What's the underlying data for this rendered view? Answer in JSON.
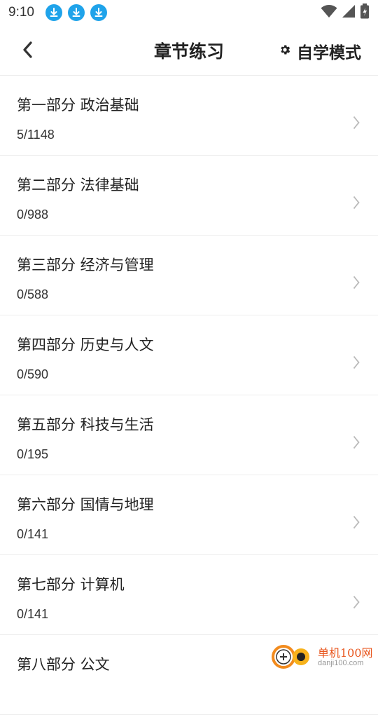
{
  "status_bar": {
    "time": "9:10",
    "download_icons": [
      "download-icon",
      "download-icon",
      "download-icon"
    ],
    "right_icons": [
      "wifi-icon",
      "signal-icon",
      "battery-icon"
    ]
  },
  "header": {
    "title": "章节练习",
    "mode_label": "自学模式",
    "mode_icon": "gear-icon",
    "back_icon": "back-arrow-icon"
  },
  "chapters": [
    {
      "title": "第一部分 政治基础",
      "count": "5/1148"
    },
    {
      "title": "第二部分 法律基础",
      "count": "0/988"
    },
    {
      "title": "第三部分 经济与管理",
      "count": "0/588"
    },
    {
      "title": "第四部分 历史与人文",
      "count": "0/590"
    },
    {
      "title": "第五部分 科技与生活",
      "count": "0/195"
    },
    {
      "title": "第六部分 国情与地理",
      "count": "0/141"
    },
    {
      "title": "第七部分 计算机",
      "count": "0/141"
    },
    {
      "title": "第八部分 公文",
      "count": ""
    }
  ],
  "watermark": {
    "name": "单机100网",
    "url": "danji100.com"
  },
  "colors": {
    "accent_download": "#1fa3ea",
    "watermark": "#e8541b",
    "divider": "#ececec"
  }
}
